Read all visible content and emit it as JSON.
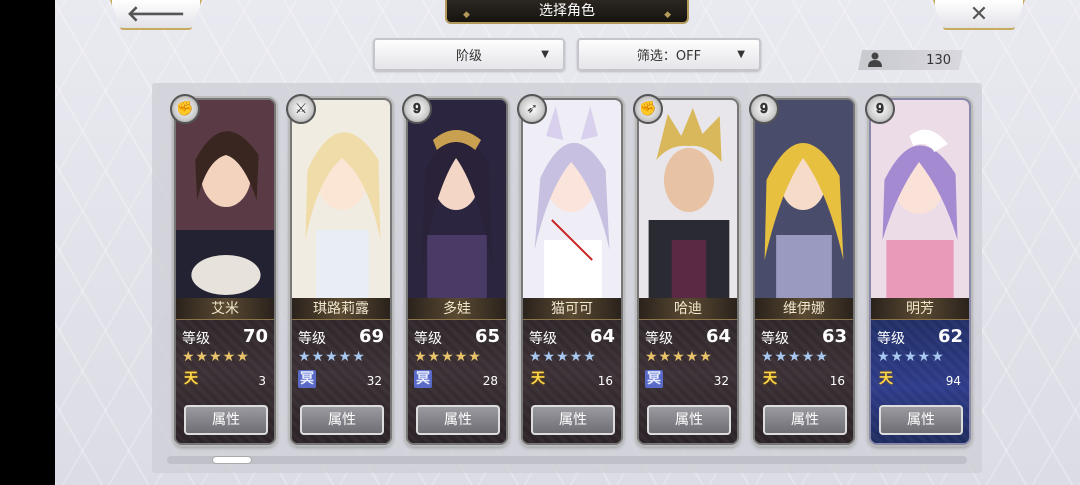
{
  "header": {
    "title": "选择角色",
    "back_icon": "left-arrow-icon",
    "close_icon": "x-icon"
  },
  "filters": {
    "rank_label": "阶级",
    "filter_label": "筛选：OFF"
  },
  "count": "130",
  "characters": [
    {
      "name": "艾米",
      "level_label": "等级",
      "level": "70",
      "stars": "★★★★★",
      "star_color": "gold",
      "grade": "天",
      "count": "3",
      "attr_label": "属性",
      "weapon": "gauntlet-icon"
    },
    {
      "name": "琪路莉露",
      "level_label": "等级",
      "level": "69",
      "stars": "★★★★★",
      "star_color": "blue",
      "grade": "冥",
      "count": "32",
      "attr_label": "属性",
      "weapon": "sword-icon"
    },
    {
      "name": "多娃",
      "level_label": "等级",
      "level": "65",
      "stars": "★★★★★",
      "star_color": "gold",
      "grade": "冥",
      "count": "28",
      "attr_label": "属性",
      "weapon": "staff-icon"
    },
    {
      "name": "猫可可",
      "level_label": "等级",
      "level": "64",
      "stars": "★★★★★",
      "star_color": "blue",
      "grade": "天",
      "count": "16",
      "attr_label": "属性",
      "weapon": "bow-icon"
    },
    {
      "name": "哈迪",
      "level_label": "等级",
      "level": "64",
      "stars": "★★★★★",
      "star_color": "gold",
      "grade": "冥",
      "count": "32",
      "attr_label": "属性",
      "weapon": "gauntlet-icon"
    },
    {
      "name": "维伊娜",
      "level_label": "等级",
      "level": "63",
      "stars": "★★★★★",
      "star_color": "blue",
      "grade": "天",
      "count": "16",
      "attr_label": "属性",
      "weapon": "staff-icon"
    },
    {
      "name": "明芳",
      "level_label": "等级",
      "level": "62",
      "stars": "★★★★★",
      "star_color": "blue",
      "grade": "天",
      "count": "94",
      "attr_label": "属性",
      "weapon": "staff-icon"
    }
  ],
  "colors": {
    "accent_gold": "#c8aa5f",
    "selected_bg": "#2e3c8a"
  }
}
